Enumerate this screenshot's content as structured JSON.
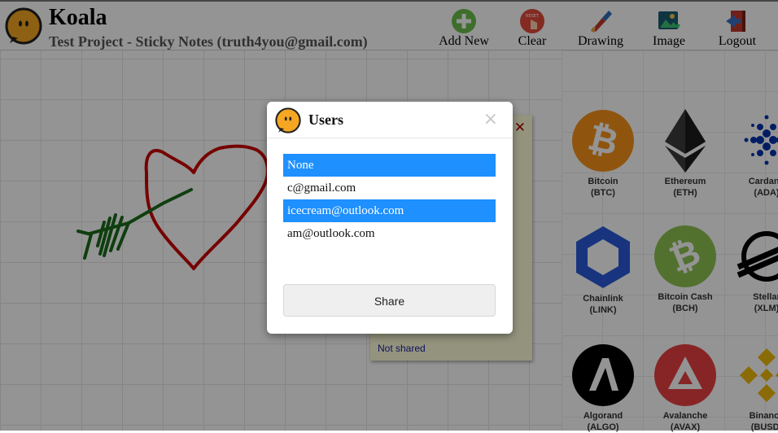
{
  "header": {
    "app_title": "Koala",
    "project_title": "Test Project - Sticky Notes (truth4you@gmail.com)",
    "tools": [
      {
        "label": "Add New",
        "icon": "plus-icon"
      },
      {
        "label": "Clear",
        "icon": "reset-icon",
        "badge": "RESET"
      },
      {
        "label": "Drawing",
        "icon": "paintbrush-icon"
      },
      {
        "label": "Image",
        "icon": "image-icon"
      },
      {
        "label": "Logout",
        "icon": "logout-icon"
      }
    ]
  },
  "sticky": {
    "close_glyph": "✕",
    "status": "Not shared"
  },
  "crypto": [
    {
      "name": "Bitcoin",
      "ticker": "(BTC)",
      "color": "#f7931a"
    },
    {
      "name": "Ethereum",
      "ticker": "(ETH)",
      "color": "#3c3c3d"
    },
    {
      "name": "Cardano",
      "ticker": "(ADA)",
      "color": "#0033ad"
    },
    {
      "name": "Chainlink",
      "ticker": "(LINK)",
      "color": "#2a5ada"
    },
    {
      "name": "Bitcoin Cash",
      "ticker": "(BCH)",
      "color": "#8dc351"
    },
    {
      "name": "Stellar",
      "ticker": "(XLM)",
      "color": "#000000"
    },
    {
      "name": "Algorand",
      "ticker": "(ALGO)",
      "color": "#000000"
    },
    {
      "name": "Avalanche",
      "ticker": "(AVAX)",
      "color": "#e84142"
    },
    {
      "name": "Binance",
      "ticker": "(BUSD)",
      "color": "#f0b90b"
    }
  ],
  "modal": {
    "title": "Users",
    "close_glyph": "×",
    "users": [
      {
        "label": "None",
        "selected": true
      },
      {
        "label": "c@gmail.com",
        "selected": false
      },
      {
        "label": "icecream@outlook.com",
        "selected": true
      },
      {
        "label": "am@outlook.com",
        "selected": false
      }
    ],
    "share_label": "Share"
  },
  "colors": {
    "selection": "#1e90ff",
    "heart": "#cc0000",
    "arrow": "#1a6b1a",
    "koala_orange": "#f5a623"
  }
}
